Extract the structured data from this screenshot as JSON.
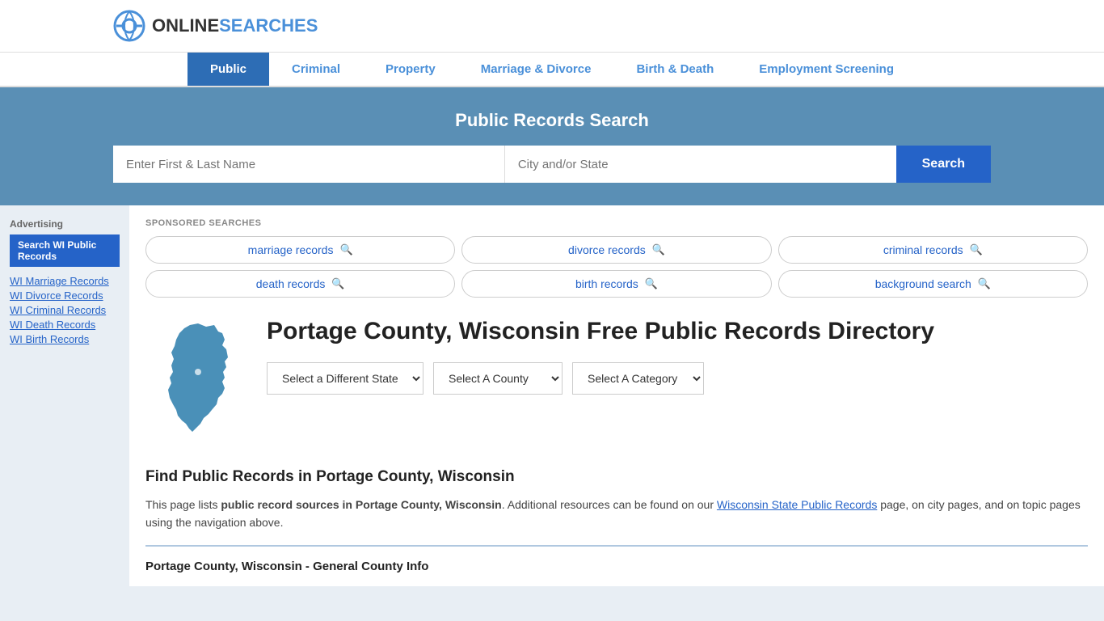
{
  "logo": {
    "text_online": "ONLINE",
    "text_searches": "SEARCHES"
  },
  "nav": {
    "items": [
      {
        "label": "Public",
        "active": true
      },
      {
        "label": "Criminal",
        "active": false
      },
      {
        "label": "Property",
        "active": false
      },
      {
        "label": "Marriage & Divorce",
        "active": false
      },
      {
        "label": "Birth & Death",
        "active": false
      },
      {
        "label": "Employment Screening",
        "active": false
      }
    ]
  },
  "search_banner": {
    "title": "Public Records Search",
    "name_placeholder": "Enter First & Last Name",
    "location_placeholder": "City and/or State",
    "search_btn": "Search"
  },
  "sponsored": {
    "label": "SPONSORED SEARCHES",
    "tags": [
      {
        "label": "marriage records"
      },
      {
        "label": "divorce records"
      },
      {
        "label": "criminal records"
      },
      {
        "label": "death records"
      },
      {
        "label": "birth records"
      },
      {
        "label": "background search"
      }
    ]
  },
  "county": {
    "title": "Portage County, Wisconsin Free Public Records Directory",
    "dropdowns": {
      "state": "Select a Different State",
      "county": "Select A County",
      "category": "Select A Category"
    }
  },
  "find": {
    "title": "Find Public Records in Portage County, Wisconsin",
    "text_before": "This page lists ",
    "text_bold": "public record sources in Portage County, Wisconsin",
    "text_after": ". Additional resources can be found on our ",
    "link_text": "Wisconsin State Public Records",
    "text_end": " page, on city pages, and on topic pages using the navigation above."
  },
  "general_info": {
    "title": "Portage County, Wisconsin - General County Info"
  },
  "sidebar": {
    "ad_label": "Advertising",
    "ad_btn": "Search WI Public Records",
    "links": [
      "WI Marriage Records",
      "WI Divorce Records",
      "WI Criminal Records",
      "WI Death Records",
      "WI Birth Records"
    ]
  }
}
